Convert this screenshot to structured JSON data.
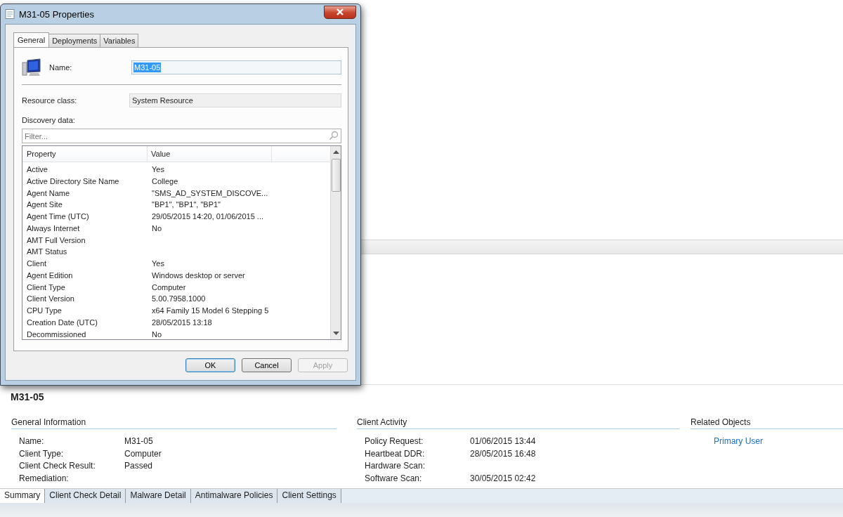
{
  "dialog": {
    "title": "M31-05 Properties",
    "tabs": [
      {
        "label": "General",
        "selected": true
      },
      {
        "label": "Deployments",
        "selected": false
      },
      {
        "label": "Variables",
        "selected": false
      }
    ],
    "name_label": "Name:",
    "name_value": "M31-05",
    "name_highlighted": true,
    "resource_class_label": "Resource class:",
    "resource_class_value": "System Resource",
    "discovery_label": "Discovery data:",
    "filter_placeholder": "Filter...",
    "columns": [
      "Property",
      "Value"
    ],
    "rows": [
      {
        "property": "Active",
        "value": "Yes"
      },
      {
        "property": "Active Directory Site Name",
        "value": "College"
      },
      {
        "property": "Agent Name",
        "value": "\"SMS_AD_SYSTEM_DISCOVE..."
      },
      {
        "property": "Agent Site",
        "value": "\"BP1\", \"BP1\", \"BP1\""
      },
      {
        "property": "Agent Time (UTC)",
        "value": "29/05/2015 14:20, 01/06/2015 ..."
      },
      {
        "property": "Always Internet",
        "value": "No"
      },
      {
        "property": "AMT Full Version",
        "value": ""
      },
      {
        "property": "AMT Status",
        "value": ""
      },
      {
        "property": "Client",
        "value": "Yes"
      },
      {
        "property": "Agent Edition",
        "value": "Windows desktop or server"
      },
      {
        "property": "Client Type",
        "value": "Computer"
      },
      {
        "property": "Client Version",
        "value": "5.00.7958.1000"
      },
      {
        "property": "CPU Type",
        "value": "x64 Family 15 Model 6 Stepping 5"
      },
      {
        "property": "Creation Date (UTC)",
        "value": "28/05/2015 13:18"
      },
      {
        "property": "Decommissioned",
        "value": "No"
      }
    ],
    "buttons": [
      {
        "label": "OK",
        "default": true,
        "disabled": false
      },
      {
        "label": "Cancel",
        "default": false,
        "disabled": false
      },
      {
        "label": "Apply",
        "default": false,
        "disabled": true
      }
    ]
  },
  "details": {
    "title": "M31-05",
    "sections": [
      {
        "heading": "General Information",
        "rows": [
          {
            "label": "Name:",
            "value": "M31-05"
          },
          {
            "label": "Client Type:",
            "value": "Computer"
          },
          {
            "label": "Client Check Result:",
            "value": "Passed"
          },
          {
            "label": "Remediation:",
            "value": ""
          }
        ]
      },
      {
        "heading": "Client Activity",
        "rows": [
          {
            "label": "Policy Request:",
            "value": "01/06/2015 13:44"
          },
          {
            "label": "Heartbeat DDR:",
            "value": "28/05/2015 16:48"
          },
          {
            "label": "Hardware Scan:",
            "value": ""
          },
          {
            "label": "Software Scan:",
            "value": "30/05/2015 02:42"
          }
        ]
      }
    ],
    "related": {
      "heading": "Related Objects",
      "links": [
        "Primary User"
      ]
    },
    "tabs": [
      {
        "label": "Summary",
        "selected": true
      },
      {
        "label": "Client Check Detail",
        "selected": false
      },
      {
        "label": "Malware Detail",
        "selected": false
      },
      {
        "label": "Antimalware Policies",
        "selected": false
      },
      {
        "label": "Client Settings",
        "selected": false
      }
    ]
  }
}
